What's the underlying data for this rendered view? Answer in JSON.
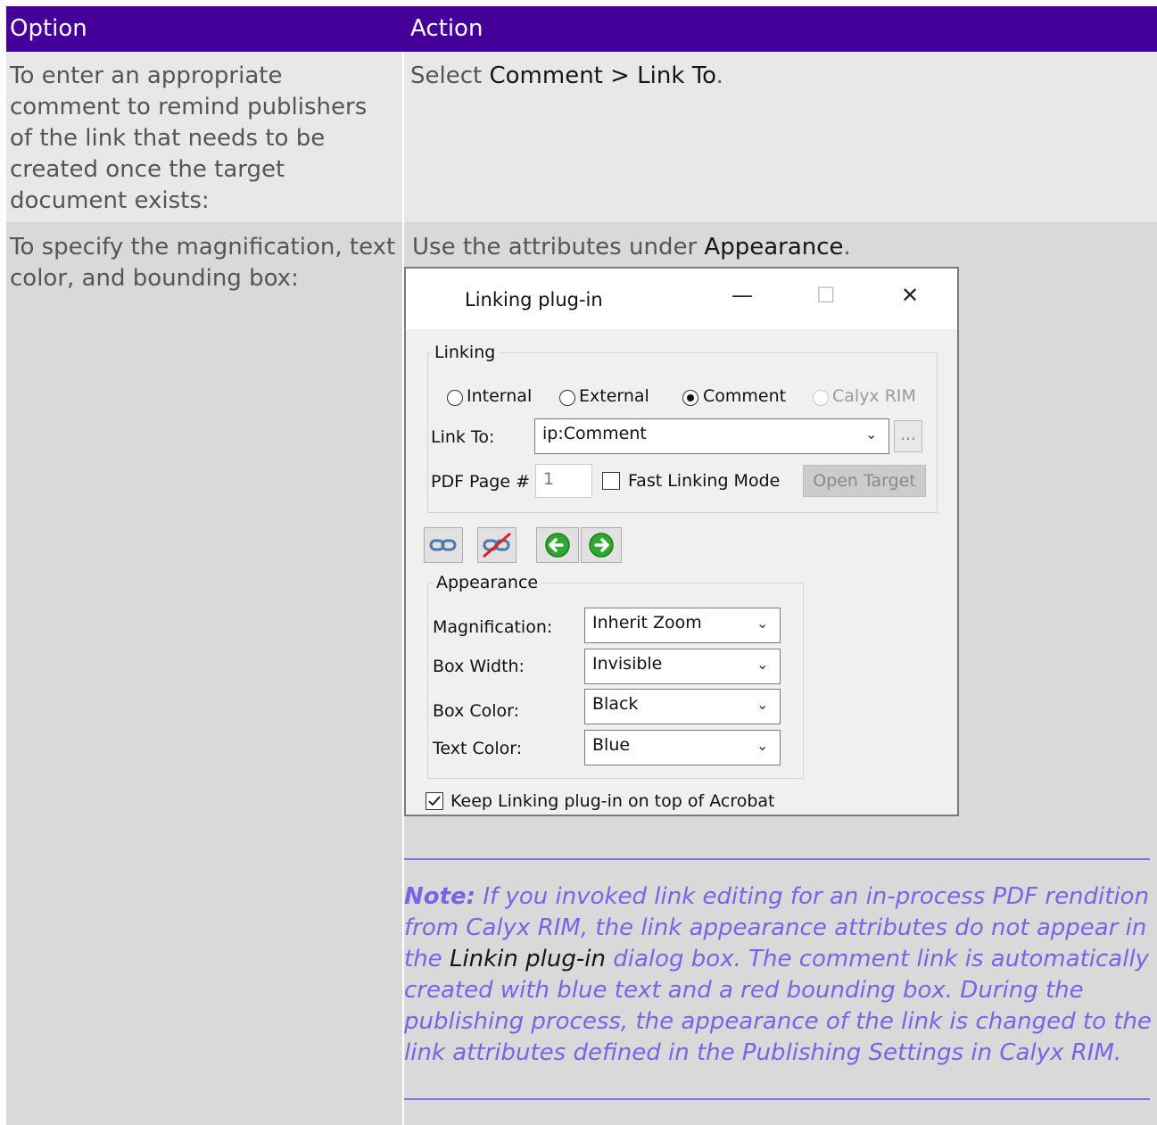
{
  "table": {
    "headers": [
      "Option",
      "Action"
    ],
    "row1": {
      "option_lines": [
        "To enter an appropriate",
        "comment to remind publishers",
        "of the link that needs to be",
        "created once the target",
        "document exists:"
      ],
      "action_prefix": "Select ",
      "action_ui": "Comment > Link To",
      "action_suffix": "."
    },
    "row2": {
      "option_lines": [
        "To specify the magnification, text",
        "color, and bounding box:"
      ],
      "action_prefix": "Use the attributes under ",
      "action_ui": "Appearance",
      "action_suffix": "."
    }
  },
  "dialog": {
    "title": "Linking plug-in",
    "minimize": "—",
    "maximize": "☐",
    "close": "✕",
    "linking_group": "Linking",
    "radios": {
      "internal": "Internal",
      "external": "External",
      "comment": "Comment",
      "calyx": "Calyx RIM",
      "selected": "Comment"
    },
    "link_to_label": "Link To:",
    "link_to_value": "ip:Comment",
    "browse_label": "...",
    "pdf_page_label": "PDF Page #",
    "pdf_page_value": "1",
    "fast_linking": "Fast Linking Mode",
    "open_target": "Open Target",
    "appearance_group": "Appearance",
    "fields": [
      {
        "label": "Magnification:",
        "value": "Inherit Zoom"
      },
      {
        "label": "Box Width:",
        "value": "Invisible"
      },
      {
        "label": "Box Color:",
        "value": "Black"
      },
      {
        "label": "Text Color:",
        "value": "Blue"
      }
    ],
    "keep_on_top": "Keep Linking plug-in on top of Acrobat",
    "keep_on_top_checked": true
  },
  "note": {
    "label": "Note:",
    "part1": " If you invoked link editing for an in-process PDF rendition from Calyx RIM, the link appearance attributes do not appear in the ",
    "ui_name": "Linkin plug-in",
    "part2": " dialog box. The comment link is automatically created with blue text and a red bounding box. During the publishing process, the appearance of the link is changed to the link attributes defined in the Publishing Settings in Calyx RIM."
  },
  "colors": {
    "header_bg": "#450099",
    "note_text": "#7b62e6"
  }
}
